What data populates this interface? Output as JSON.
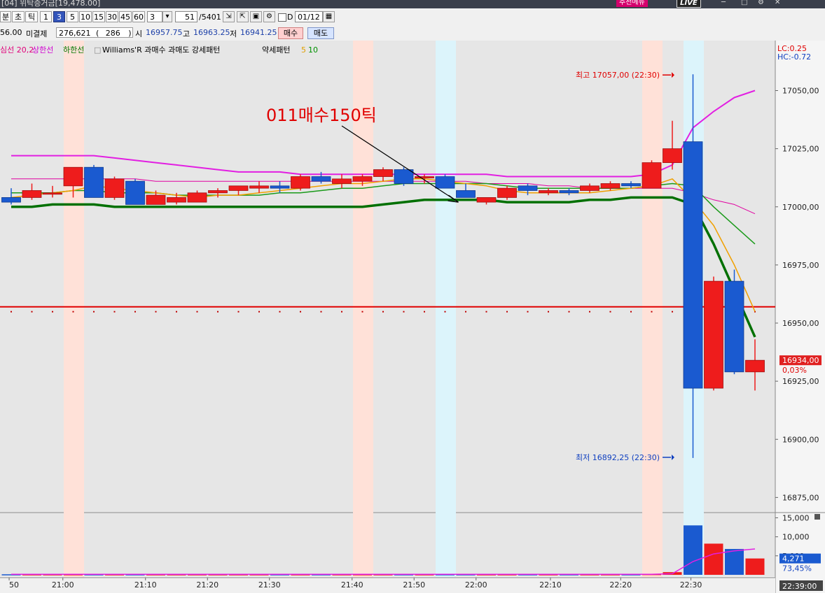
{
  "window": {
    "title": "[04] 위탁증거금[19,478.00]",
    "menu_label": "추천메뉴",
    "live_label": "LIVE"
  },
  "toolbar": {
    "periods": [
      "분",
      "초",
      "틱"
    ],
    "intervals": [
      "1",
      "3",
      "5",
      "10",
      "15",
      "30",
      "45",
      "60"
    ],
    "active_interval": "3",
    "interval_value": "3",
    "count_value": "51",
    "count_total": "/5401",
    "d_label": "D",
    "date_value": "01/12"
  },
  "quote": {
    "prev": "56.00",
    "oi_label": "미결제",
    "oi_value": "276,621",
    "oi_change": "286",
    "open_label": "시",
    "open": "16957.75",
    "high_label": "고",
    "high": "16963.25",
    "low_label": "저",
    "low": "16941.25",
    "buy_label": "매수",
    "sell_label": "매도"
  },
  "legend": [
    {
      "text": "심선 20,2",
      "color": "#e0007a"
    },
    {
      "text": "상한선",
      "color": "#d000d0"
    },
    {
      "text": "하한선",
      "color": "#007700"
    },
    {
      "text": "□",
      "color": "#888888"
    },
    {
      "text": "Williams'R 과매수 과매도 강세패턴",
      "color": "#000000"
    },
    {
      "text": "약세패턴",
      "color": "#000000"
    },
    {
      "text": "5",
      "color": "#e0a000"
    },
    {
      "text": "10",
      "color": "#009000"
    }
  ],
  "indicator_labels": {
    "lc": "LC:0.25",
    "hc": "HC:-0.72"
  },
  "chart_data": {
    "type": "candlestick",
    "bar_minutes": 3,
    "x_tick_labels": [
      "50",
      "21:00",
      "21:10",
      "21:20",
      "21:30",
      "21:40",
      "21:50",
      "22:00",
      "22:10",
      "22:20",
      "22:30"
    ],
    "current_time": "22:39:00",
    "y_range": [
      16870,
      17070
    ],
    "y_tick_labels": [
      "17050,00",
      "17025,00",
      "17000,00",
      "16975,00",
      "16950,00",
      "16925,00",
      "16900,00",
      "16875,00"
    ],
    "y_ticks": [
      17050,
      17025,
      17000,
      16975,
      16950,
      16925,
      16900,
      16875
    ],
    "candles": [
      {
        "o": 17004,
        "h": 17008,
        "l": 17001,
        "c": 17002
      },
      {
        "o": 17004,
        "h": 17010,
        "l": 17003,
        "c": 17007
      },
      {
        "o": 17006,
        "h": 17009,
        "l": 17004,
        "c": 17006
      },
      {
        "o": 17009,
        "h": 17017,
        "l": 17004,
        "c": 17017
      },
      {
        "o": 17017,
        "h": 17018,
        "l": 17004,
        "c": 17004
      },
      {
        "o": 17004,
        "h": 17013,
        "l": 17003,
        "c": 17012
      },
      {
        "o": 17011,
        "h": 17012,
        "l": 17001,
        "c": 17001
      },
      {
        "o": 17001,
        "h": 17007,
        "l": 17001,
        "c": 17005
      },
      {
        "o": 17002,
        "h": 17006,
        "l": 17001,
        "c": 17004
      },
      {
        "o": 17002,
        "h": 17007,
        "l": 17002,
        "c": 17006
      },
      {
        "o": 17006,
        "h": 17008,
        "l": 17004,
        "c": 17007
      },
      {
        "o": 17007,
        "h": 17009,
        "l": 17005,
        "c": 17009
      },
      {
        "o": 17008,
        "h": 17011,
        "l": 17006,
        "c": 17009
      },
      {
        "o": 17009,
        "h": 17011,
        "l": 17006,
        "c": 17008
      },
      {
        "o": 17008,
        "h": 17014,
        "l": 17007,
        "c": 17013
      },
      {
        "o": 17013,
        "h": 17015,
        "l": 17010,
        "c": 17011
      },
      {
        "o": 17010,
        "h": 17014,
        "l": 17008,
        "c": 17012
      },
      {
        "o": 17011,
        "h": 17014,
        "l": 17009,
        "c": 17013
      },
      {
        "o": 17013,
        "h": 17017,
        "l": 17011,
        "c": 17016
      },
      {
        "o": 17016,
        "h": 17017,
        "l": 17009,
        "c": 17010
      },
      {
        "o": 17013,
        "h": 17014,
        "l": 17010,
        "c": 17013
      },
      {
        "o": 17013,
        "h": 17014,
        "l": 17008,
        "c": 17008
      },
      {
        "o": 17007,
        "h": 17010,
        "l": 17004,
        "c": 17004
      },
      {
        "o": 17002,
        "h": 17004,
        "l": 17001,
        "c": 17004
      },
      {
        "o": 17004,
        "h": 17009,
        "l": 17003,
        "c": 17008
      },
      {
        "o": 17009,
        "h": 17010,
        "l": 17005,
        "c": 17007
      },
      {
        "o": 17006,
        "h": 17008,
        "l": 17005,
        "c": 17007
      },
      {
        "o": 17007,
        "h": 17008,
        "l": 17005,
        "c": 17006
      },
      {
        "o": 17007,
        "h": 17010,
        "l": 17006,
        "c": 17009
      },
      {
        "o": 17008,
        "h": 17011,
        "l": 17007,
        "c": 17010
      },
      {
        "o": 17010,
        "h": 17011,
        "l": 17008,
        "c": 17009
      },
      {
        "o": 17008,
        "h": 17020,
        "l": 17008,
        "c": 17019
      },
      {
        "o": 17019,
        "h": 17037,
        "l": 17016,
        "c": 17025
      },
      {
        "o": 17028,
        "h": 17057,
        "l": 16892,
        "c": 16922
      },
      {
        "o": 16922,
        "h": 16970,
        "l": 16921,
        "c": 16968
      },
      {
        "o": 16968,
        "h": 16973,
        "l": 16928,
        "c": 16929
      },
      {
        "o": 16929,
        "h": 16943,
        "l": 16921,
        "c": 16934
      }
    ],
    "upper_band": [
      17022,
      17022,
      17022,
      17022,
      17022,
      17021,
      17020,
      17019,
      17018,
      17017,
      17016,
      17015,
      17015,
      17015,
      17014,
      17014,
      17014,
      17014,
      17014,
      17014,
      17014,
      17014,
      17014,
      17014,
      17013,
      17013,
      17013,
      17013,
      17013,
      17013,
      17013,
      17014,
      17018,
      17034,
      17041,
      17047,
      17050
    ],
    "lower_band": [
      17000,
      17000,
      17001,
      17001,
      17001,
      17000,
      17000,
      17000,
      17000,
      17000,
      17000,
      17000,
      17000,
      17000,
      17000,
      17000,
      17000,
      17000,
      17001,
      17002,
      17003,
      17003,
      17003,
      17003,
      17002,
      17002,
      17002,
      17002,
      17003,
      17003,
      17004,
      17004,
      17004,
      17001,
      16984,
      16964,
      16944
    ],
    "ma5": [
      17004,
      17005,
      17006,
      17007,
      17009,
      17008,
      17007,
      17006,
      17005,
      17004,
      17005,
      17005,
      17006,
      17007,
      17008,
      17009,
      17010,
      17010,
      17011,
      17012,
      17012,
      17011,
      17010,
      17009,
      17007,
      17006,
      17006,
      17006,
      17006,
      17007,
      17008,
      17009,
      17012,
      17003,
      16992,
      16975,
      16955
    ],
    "ma10": [
      17006,
      17006,
      17006,
      17007,
      17007,
      17006,
      17006,
      17006,
      17005,
      17005,
      17005,
      17005,
      17005,
      17006,
      17006,
      17007,
      17008,
      17008,
      17009,
      17010,
      17010,
      17010,
      17010,
      17010,
      17009,
      17008,
      17008,
      17008,
      17008,
      17008,
      17008,
      17009,
      17010,
      17009,
      17000,
      16992,
      16984
    ],
    "mid_line": [
      17012,
      17012,
      17012,
      17012,
      17012,
      17012,
      17012,
      17011,
      17011,
      17011,
      17011,
      17011,
      17011,
      17011,
      17011,
      17011,
      17011,
      17011,
      17011,
      17011,
      17011,
      17011,
      17011,
      17010,
      17010,
      17010,
      17009,
      17009,
      17008,
      17008,
      17008,
      17008,
      17008,
      17006,
      17003,
      17001,
      16997
    ],
    "horizontal_line": 16957,
    "high_marker": {
      "label": "최고 17057,00 (22:30)",
      "value": 17057
    },
    "low_marker": {
      "label": "최저 16892,25 (22:30)",
      "value": 16892.25
    },
    "price_tag": {
      "value": "16934,00",
      "change": "0,03%"
    },
    "annotation": {
      "text": "011매수150틱"
    },
    "highlight_bars": [
      {
        "index": 3,
        "color": "#ffe1d8"
      },
      {
        "index": 17,
        "color": "#ffe1d8"
      },
      {
        "index": 21,
        "color": "#dcf4fb"
      },
      {
        "index": 31,
        "color": "#ffe1d8"
      },
      {
        "index": 33,
        "color": "#dcf4fb"
      }
    ],
    "volume": {
      "y_range": [
        0,
        16000
      ],
      "y_tick_labels": [
        "15,000",
        "10,000",
        "5,000"
      ],
      "y_ticks": [
        15000,
        10000,
        5000
      ],
      "values": [
        140,
        140,
        140,
        140,
        140,
        140,
        140,
        140,
        140,
        140,
        140,
        140,
        140,
        140,
        140,
        140,
        140,
        140,
        140,
        140,
        140,
        140,
        140,
        140,
        140,
        140,
        140,
        140,
        140,
        140,
        140,
        200,
        700,
        13000,
        8200,
        6800,
        4300
      ],
      "avg": [
        140,
        140,
        140,
        140,
        140,
        140,
        140,
        140,
        140,
        140,
        140,
        140,
        140,
        140,
        140,
        140,
        140,
        140,
        140,
        140,
        140,
        140,
        140,
        140,
        140,
        140,
        140,
        140,
        140,
        140,
        140,
        140,
        300,
        3500,
        5500,
        6300,
        6800
      ],
      "last_tag": "4,271",
      "last_pct": "73,45%"
    }
  }
}
